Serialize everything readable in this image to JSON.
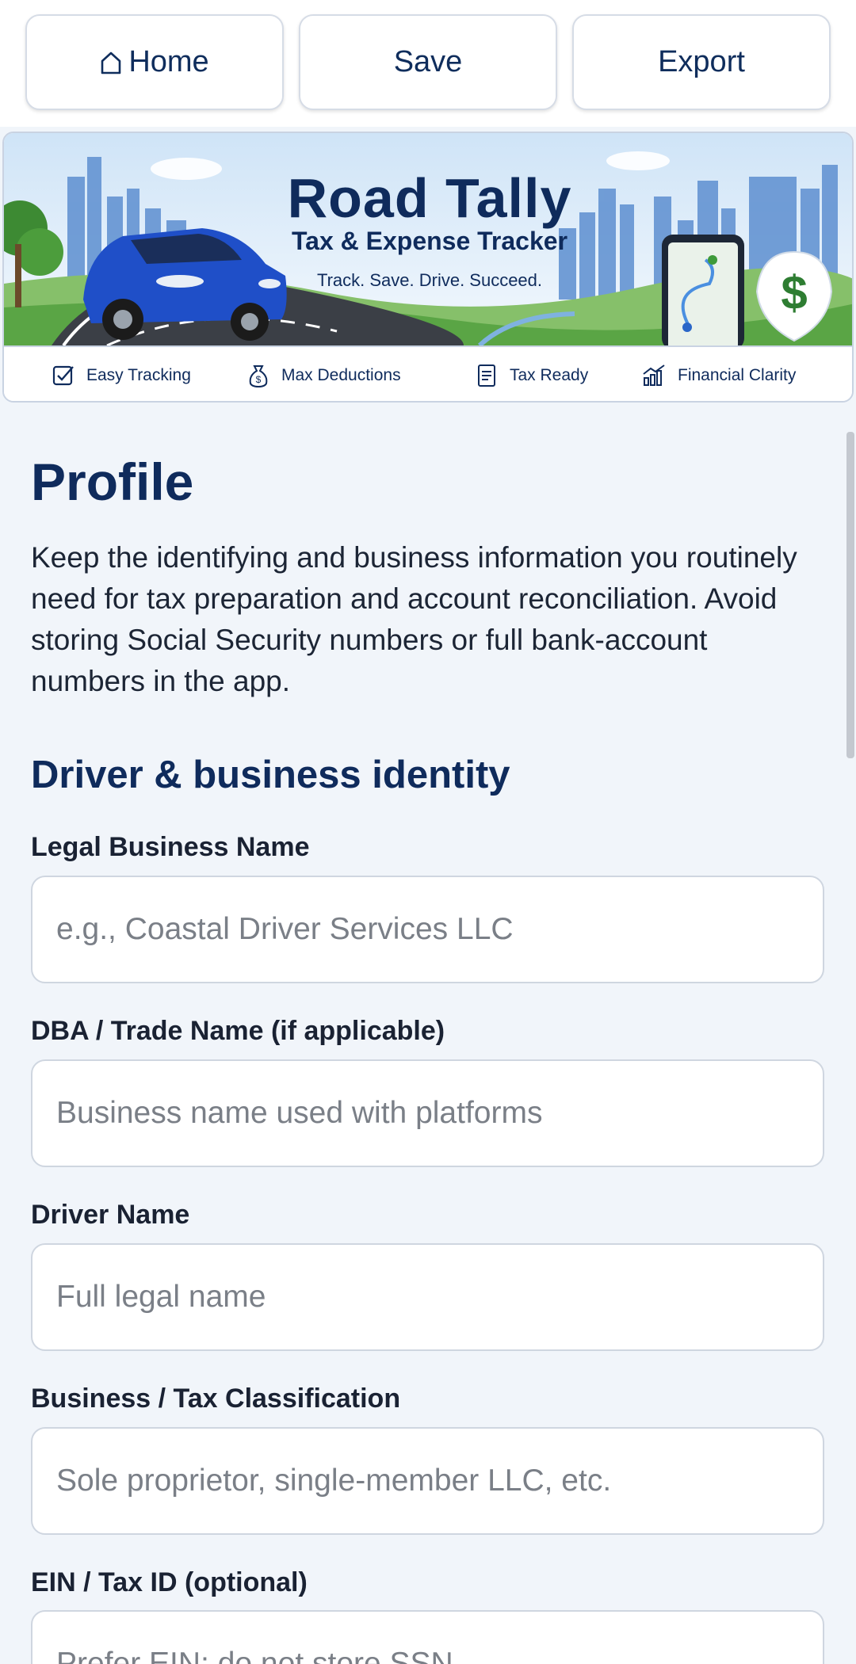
{
  "nav": {
    "home_label": "Home",
    "save_label": "Save",
    "export_label": "Export"
  },
  "banner": {
    "title": "Road Tally",
    "subtitle": "Tax & Expense Tracker",
    "tagline": "Track. Save. Drive. Succeed.",
    "features": [
      {
        "label": "Easy Tracking",
        "icon": "checkbox-icon"
      },
      {
        "label": "Max Deductions",
        "icon": "money-bag-icon"
      },
      {
        "label": "Tax Ready",
        "icon": "document-icon"
      },
      {
        "label": "Financial Clarity",
        "icon": "growth-chart-icon"
      }
    ]
  },
  "page": {
    "title": "Profile",
    "intro": "Keep the identifying and business information you routinely need for tax preparation and account reconciliation. Avoid storing Social Security numbers or full bank-account numbers in the app."
  },
  "section": {
    "title": "Driver & business identity"
  },
  "fields": [
    {
      "label": "Legal Business Name",
      "placeholder": "e.g., Coastal Driver Services LLC",
      "value": ""
    },
    {
      "label": "DBA / Trade Name (if applicable)",
      "placeholder": "Business name used with platforms",
      "value": ""
    },
    {
      "label": "Driver Name",
      "placeholder": "Full legal name",
      "value": ""
    },
    {
      "label": "Business / Tax Classification",
      "placeholder": "Sole proprietor, single-member LLC, etc.",
      "value": ""
    },
    {
      "label": "EIN / Tax ID (optional)",
      "placeholder": "Prefer EIN; do not store SSN",
      "value": ""
    }
  ],
  "colors": {
    "accent": "#0f2b5c",
    "background": "#f1f5fa",
    "money_green": "#2e7d32"
  }
}
